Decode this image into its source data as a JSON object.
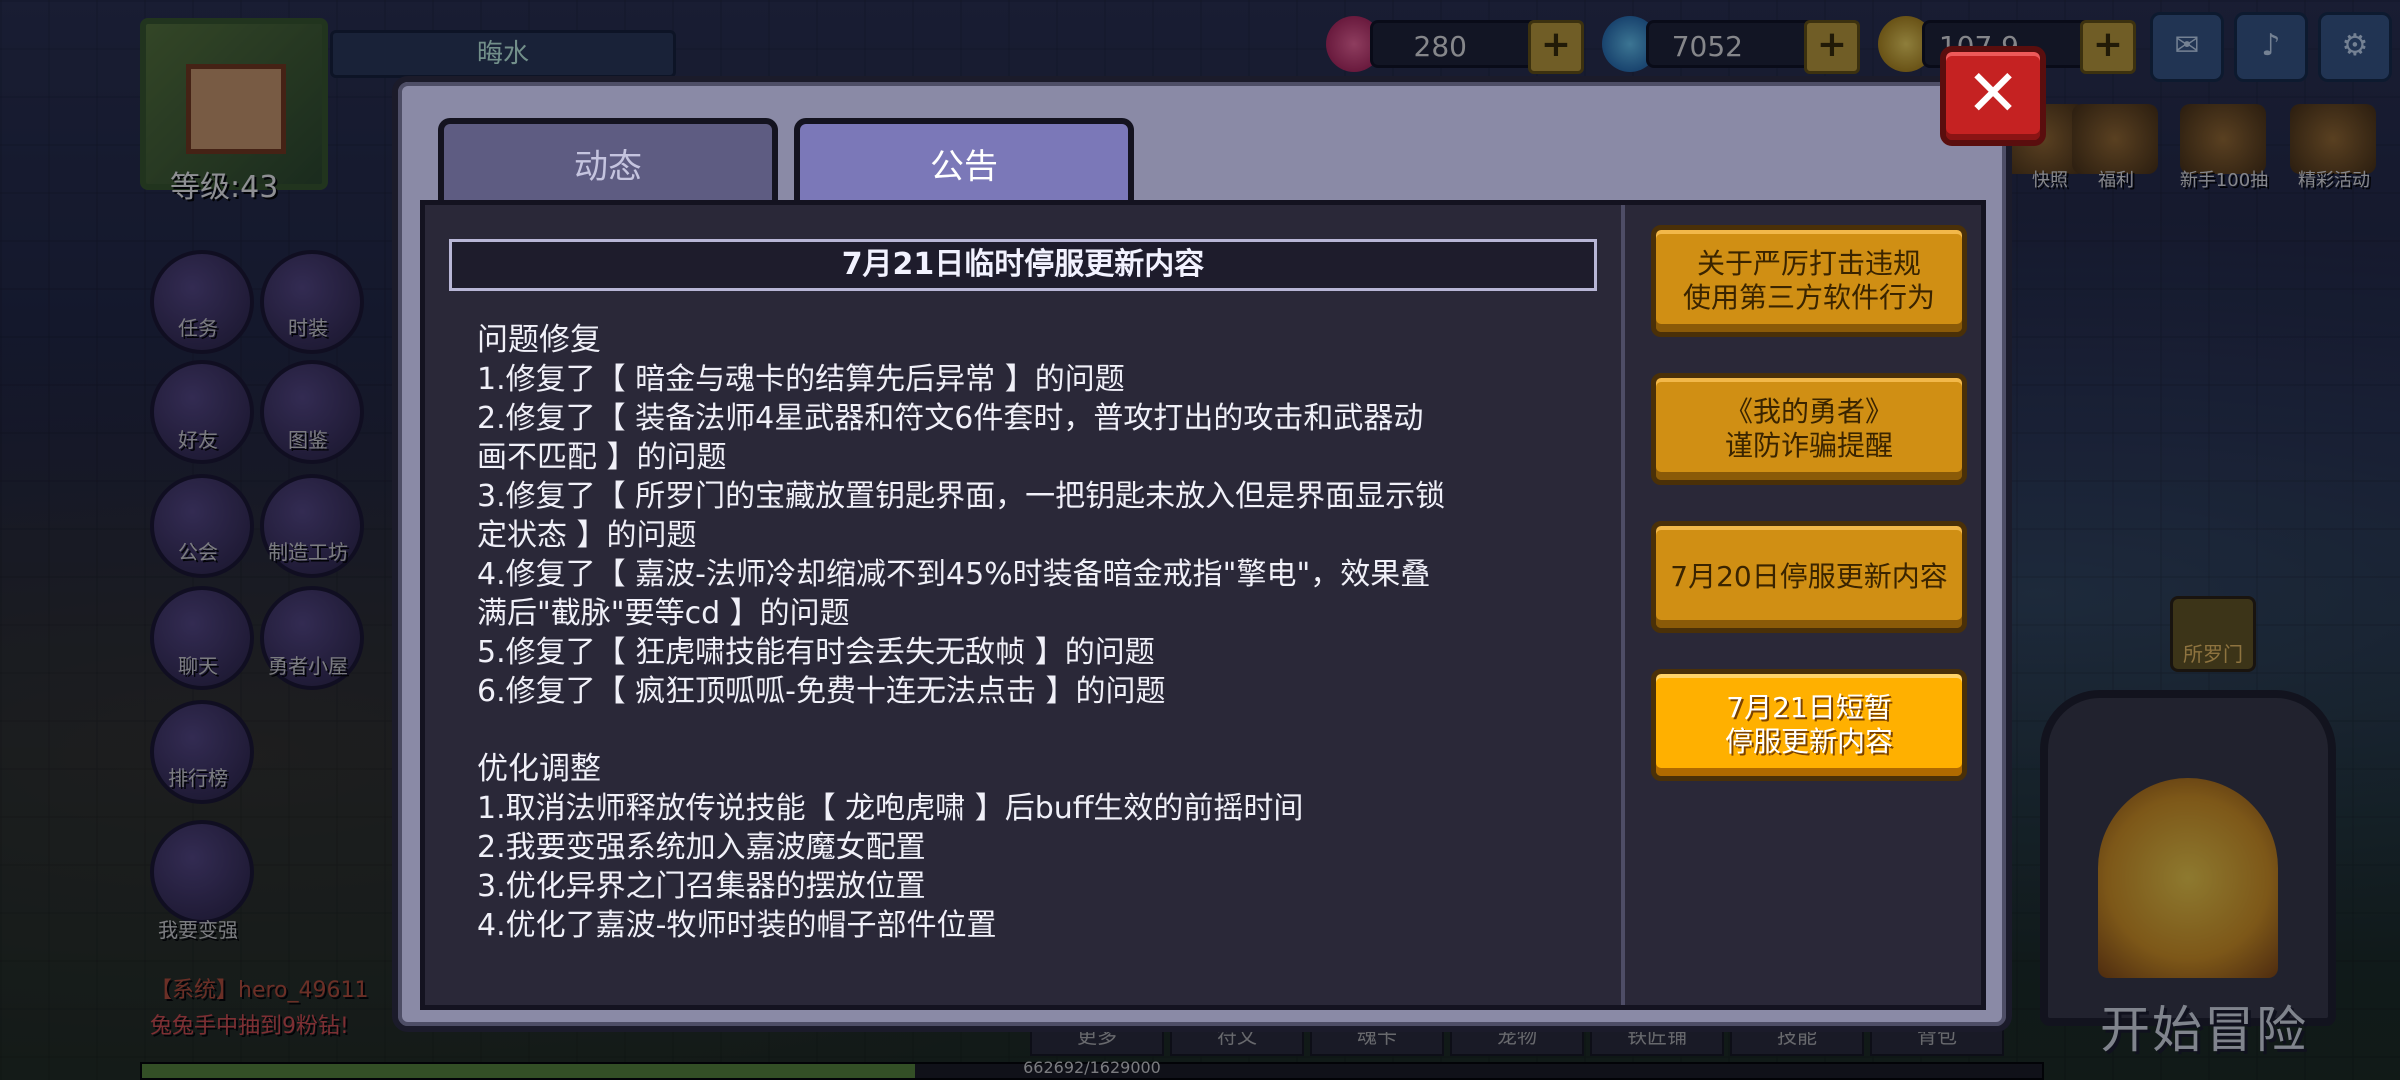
{
  "hud": {
    "player_name": "晦水",
    "level_label": "等级:43",
    "resources": [
      {
        "icon": "pink-gem-icon",
        "value": "280"
      },
      {
        "icon": "blue-diamond-icon",
        "value": "7052"
      },
      {
        "icon": "gold-coin-icon",
        "value": "107.9万"
      }
    ],
    "top_buttons": [
      "mail-icon",
      "sound-icon",
      "settings-icon"
    ],
    "left_menu": [
      "任务",
      "时装",
      "好友",
      "图鉴",
      "公会",
      "制造工坊",
      "聊天",
      "勇者小屋",
      "排行榜",
      "我要变强"
    ],
    "right_events": [
      "快照",
      "福利",
      "新手100抽",
      "精彩活动"
    ],
    "portal_label": "所罗门",
    "start_adventure": "开始冒险",
    "chat": [
      "【系统】hero_49611",
      "兔兔手中抽到9粉钻!"
    ],
    "bottom_tabs": [
      "更多",
      "符文",
      "魂卡",
      "宠物",
      "铁匠铺",
      "技能",
      "背包"
    ],
    "exp_text": "662692/1629000",
    "exp_fraction": 0.407
  },
  "dialog": {
    "tabs": [
      {
        "label": "动态",
        "active": false
      },
      {
        "label": "公告",
        "active": true
      }
    ],
    "close_label": "✕",
    "announcement": {
      "title": "7月21日临时停服更新内容",
      "lines": [
        "问题修复",
        "1.修复了【 暗金与魂卡的结算先后异常 】的问题",
        "2.修复了【 装备法师4星武器和符文6件套时，普攻打出的攻击和武器动",
        "画不匹配 】的问题",
        "3.修复了【 所罗门的宝藏放置钥匙界面，一把钥匙未放入但是界面显示锁",
        "定状态 】的问题",
        "4.修复了【 嘉波-法师冷却缩减不到45%时装备暗金戒指\"擎电\"，效果叠",
        "满后\"截脉\"要等cd 】的问题",
        "5.修复了【 狂虎啸技能有时会丢失无敌帧 】的问题",
        "6.修复了【 疯狂顶呱呱-免费十连无法点击 】的问题",
        "",
        "优化调整",
        "1.取消法师释放传说技能【 龙咆虎啸 】后buff生效的前摇时间",
        "2.我要变强系统加入嘉波魔女配置",
        "3.优化异界之门召集器的摆放位置",
        "4.优化了嘉波-牧师时装的帽子部件位置"
      ]
    },
    "side_list": [
      {
        "label": "关于严厉打击违规\n使用第三方软件行为",
        "selected": false
      },
      {
        "label": "《我的勇者》\n谨防诈骗提醒",
        "selected": false
      },
      {
        "label": "7月20日停服更新内容",
        "selected": false
      },
      {
        "label": "7月21日短暂\n停服更新内容",
        "selected": true
      }
    ]
  }
}
